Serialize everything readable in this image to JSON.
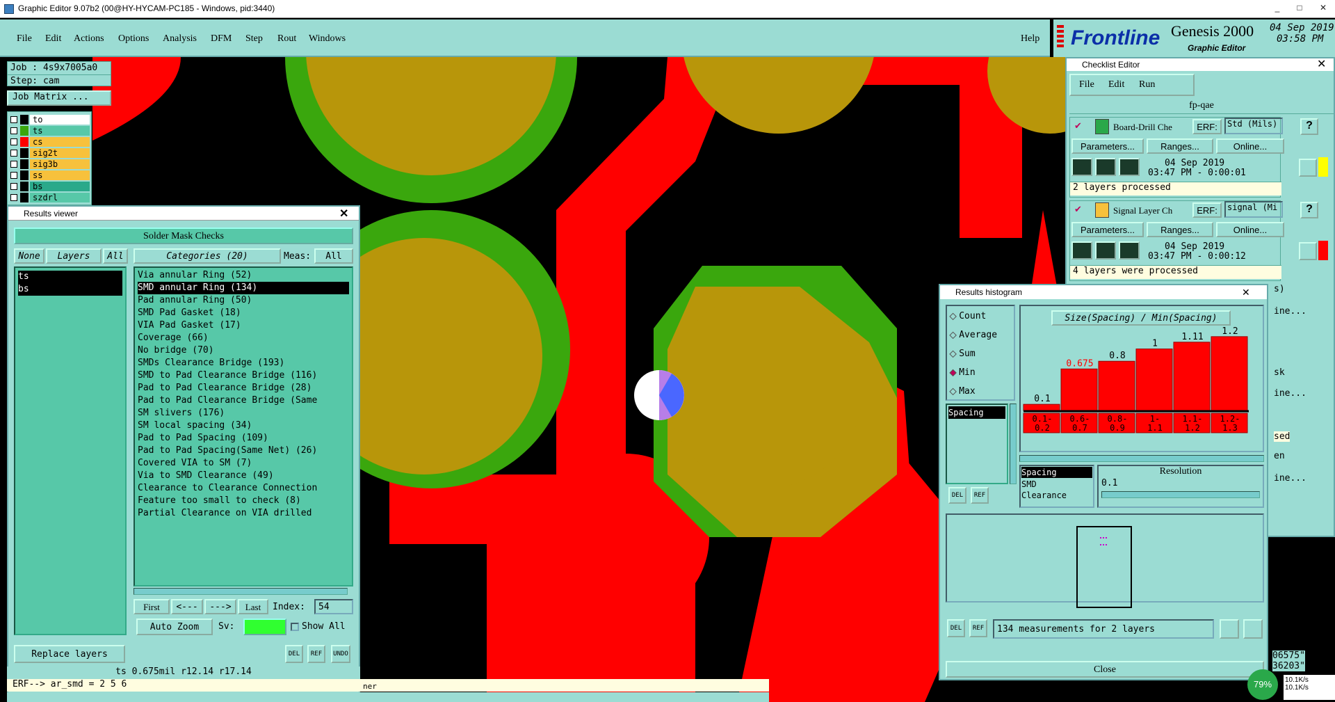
{
  "window": {
    "title": "Graphic Editor 9.07b2 (00@HY-HYCAM-PC185 - Windows, pid:3440)",
    "min": "_",
    "max": "□",
    "close": "✕"
  },
  "menu": [
    "File",
    "Edit",
    "Actions",
    "Options",
    "Analysis",
    "DFM",
    "Step",
    "Rout",
    "Windows"
  ],
  "help": "Help",
  "brand": {
    "logo": "Frontline",
    "product": "Genesis 2000",
    "subtitle": "Graphic Editor",
    "date": "04 Sep 2019",
    "time": "03:58 PM"
  },
  "job": {
    "job": "Job : 4s9x7005a0",
    "step": "Step: cam",
    "matrix": "Job Matrix ..."
  },
  "layers": [
    {
      "name": "to",
      "color": "#ffffff"
    },
    {
      "name": "ts",
      "color": "#57c8a8"
    },
    {
      "name": "cs",
      "color": "#f7c13c"
    },
    {
      "name": "sig2t",
      "color": "#f7c13c"
    },
    {
      "name": "sig3b",
      "color": "#f7c13c"
    },
    {
      "name": "ss",
      "color": "#f7c13c"
    },
    {
      "name": "bs",
      "color": "#2aa98a"
    },
    {
      "name": "szdrl",
      "color": "#57c8a8"
    }
  ],
  "results": {
    "title": "Results viewer",
    "header": "Solder Mask Checks",
    "none": "None",
    "layers": "Layers",
    "all": "All",
    "categories": "Categories (20)",
    "meas": "Meas:",
    "meas_val": "All",
    "layer_items": [
      "ts",
      "bs"
    ],
    "cats": [
      "Via annular Ring (52)",
      "SMD annular Ring (134)",
      "Pad annular Ring (50)",
      "SMD Pad Gasket (18)",
      "VIA Pad Gasket (17)",
      "Coverage (66)",
      "No bridge (70)",
      "SMDs Clearance Bridge (193)",
      "SMD to Pad Clearance Bridge (116)",
      "Pad to Pad Clearance Bridge (28)",
      "Pad to Pad Clearance Bridge (Same",
      "SM slivers (176)",
      "SM local spacing (34)",
      "Pad to Pad Spacing (109)",
      "Pad to Pad Spacing(Same Net) (26)",
      "Covered VIA to SM (7)",
      "Via to SMD Clearance (49)",
      "Clearance to Clearance Connection",
      "Feature too small to check (8)",
      "Partial Clearance on VIA drilled"
    ],
    "first": "First",
    "prev": "<---",
    "next": "--->",
    "last": "Last",
    "index_label": "Index:",
    "index": "54",
    "autozoom": "Auto Zoom",
    "sv": "Sv:",
    "showall": "Show All",
    "replace": "Replace layers",
    "del": "DEL",
    "ref": "REF",
    "undo": "UNDO"
  },
  "status": {
    "line1": "ts  0.675mil  r12.14  r17.14",
    "line2": "ERF--> ar_smd = 2 5 6",
    "tail": "ner"
  },
  "checklist": {
    "title": "Checklist Editor",
    "menu": [
      "File",
      "Edit",
      "Run"
    ],
    "name": "fp-qae",
    "items": [
      {
        "label": "Board-Drill Che",
        "erf": "ERF:",
        "erf_val": "Std (Mils)",
        "params": "Parameters...",
        "ranges": "Ranges...",
        "online": "Online...",
        "date": "04 Sep 2019",
        "time": "03:47 PM - 0:00:01",
        "status": "2 layers processed",
        "flag_color": "#ffff00"
      },
      {
        "label": "Signal Layer Ch",
        "erf": "ERF:",
        "erf_val": "signal (Mi",
        "params": "Parameters...",
        "ranges": "Ranges...",
        "online": "Online...",
        "date": "04 Sep 2019",
        "time": "03:47 PM - 0:00:12",
        "status": "4 layers were processed",
        "flag_color": "#ff0000"
      }
    ],
    "peek": [
      "s)",
      "ine...",
      "sk",
      "ine...",
      "sed",
      "en",
      "ine..."
    ],
    "help": "?"
  },
  "histogram": {
    "title": "Results histogram",
    "modes": [
      "Count",
      "Average",
      "Sum",
      "Min",
      "Max"
    ],
    "selected_mode": "Min",
    "list": [
      "Spacing"
    ],
    "chart_title": "Size(Spacing) / Min(Spacing)",
    "bins": [
      "0.1-\n0.2",
      "0.6-\n0.7",
      "0.8-\n0.9",
      "1-\n1.1",
      "1.1-\n1.2",
      "1.2-\n1.3"
    ],
    "values": [
      0.1,
      0.675,
      0.8,
      1,
      1.11,
      1.2
    ],
    "value_labels": [
      "0.1",
      "0.675",
      "0.8",
      "1",
      "1.11",
      "1.2"
    ],
    "attr_list": [
      "Spacing",
      "SMD",
      "Clearance"
    ],
    "resolution": "Resolution",
    "res_val": "0.1",
    "summary": "134 measurements for 2 layers",
    "close": "Close",
    "del": "DEL",
    "ref": "REF"
  },
  "corner": {
    "coord1": "06575\"",
    "coord2": "36203\"",
    "pct": "79%",
    "up": "10.1K/s",
    "down": "10.1K/s"
  }
}
